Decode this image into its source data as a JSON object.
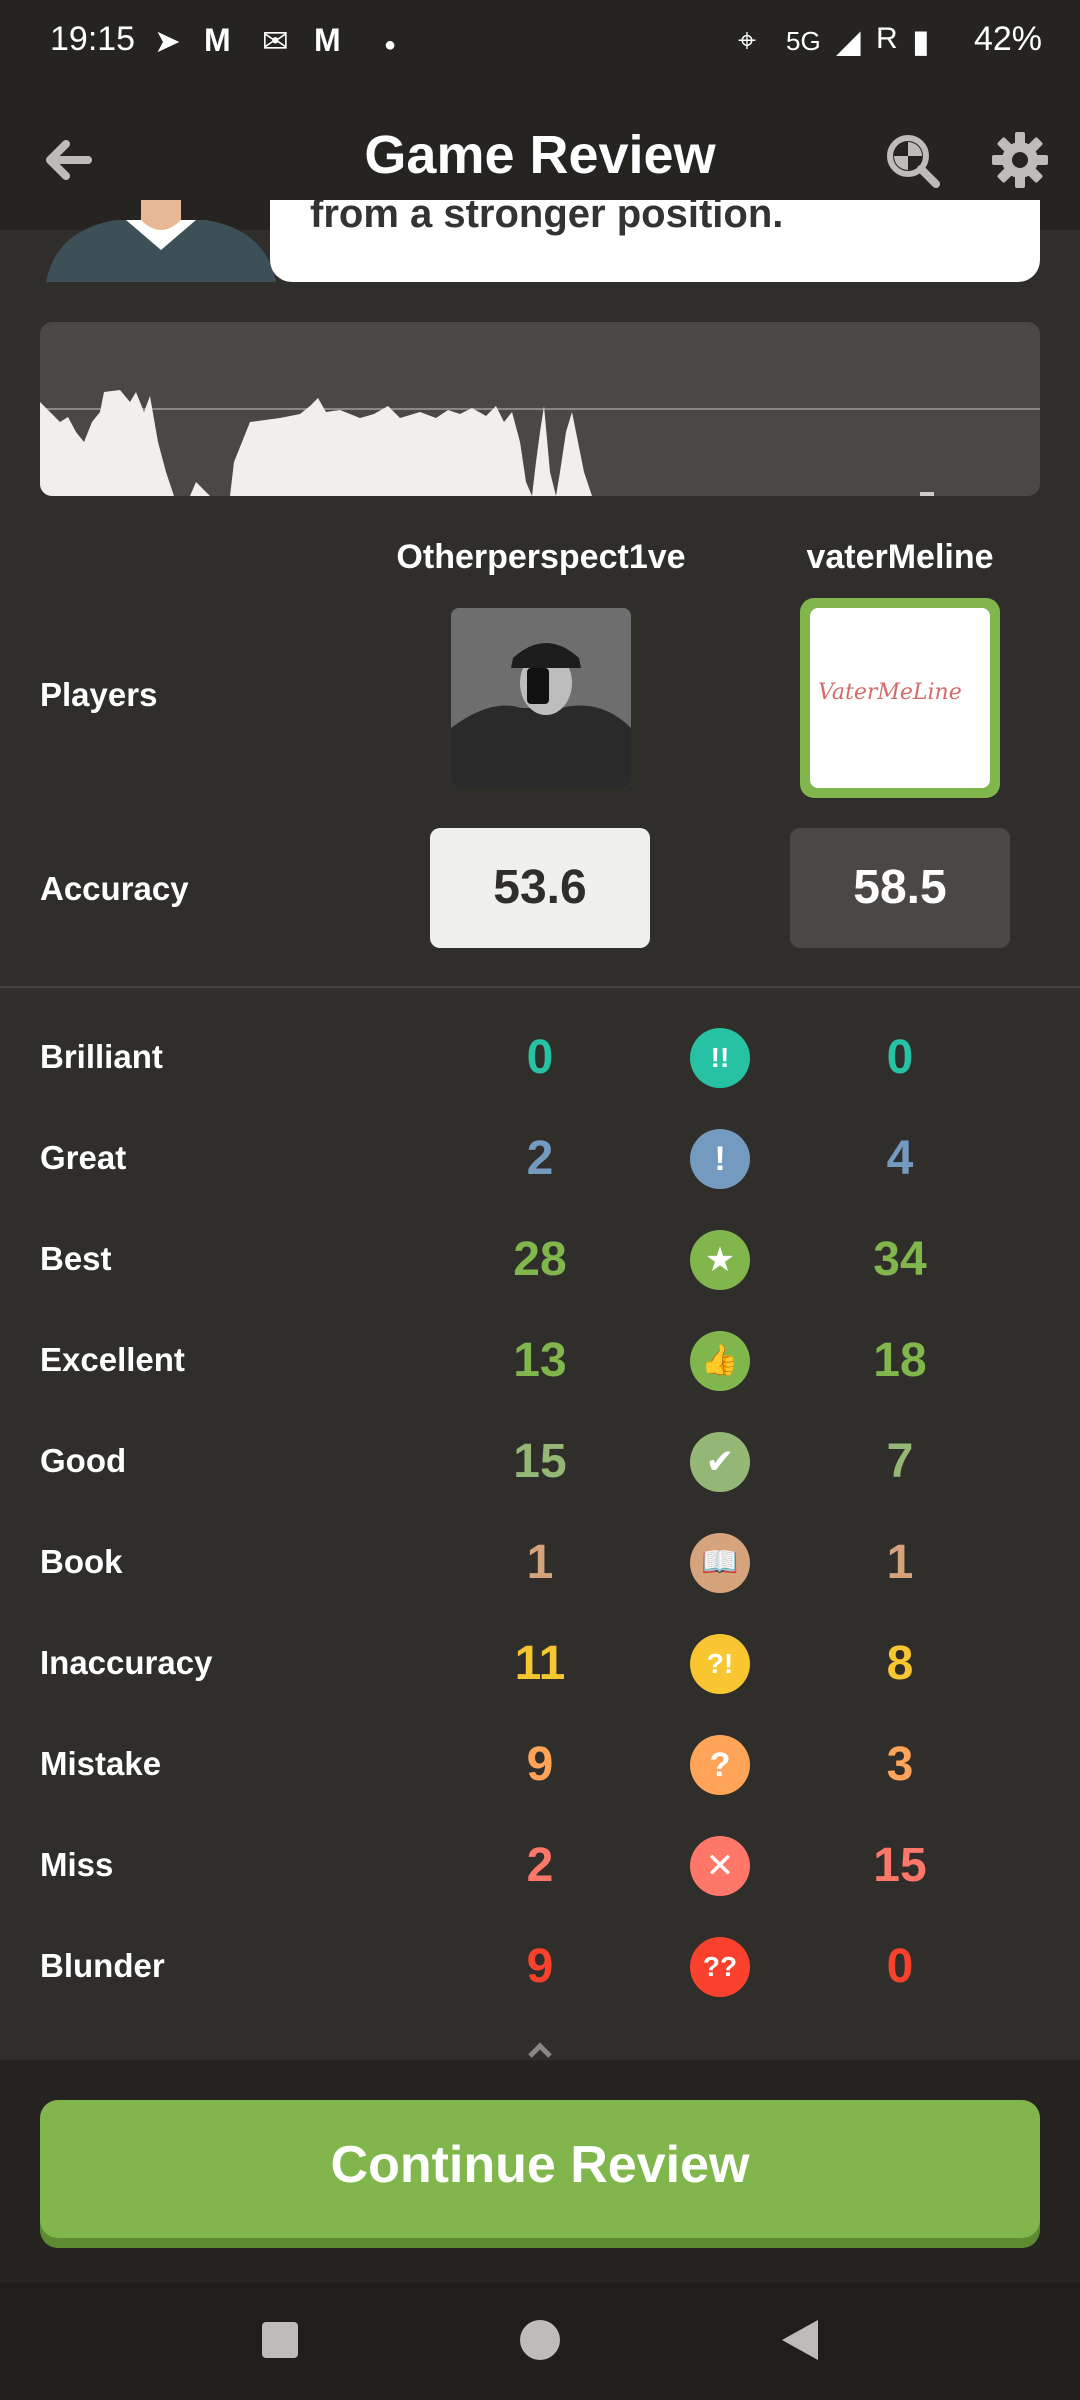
{
  "status_bar": {
    "time": "19:15",
    "network": "5G",
    "roaming": "R",
    "battery": "42%"
  },
  "header": {
    "title": "Game Review"
  },
  "coach": {
    "message": "from a stronger position."
  },
  "players": {
    "label": "Players",
    "white": {
      "name": "Otherperspect1ve",
      "accuracy": "53.6"
    },
    "black": {
      "name": "vaterMeline",
      "accuracy": "58.5",
      "avatar_text": "VaterMeLine"
    }
  },
  "accuracy_label": "Accuracy",
  "stats": [
    {
      "label": "Brilliant",
      "white": "0",
      "black": "0",
      "color": "#26c2a3",
      "icon": "!!",
      "icon_name": "brilliant-icon"
    },
    {
      "label": "Great",
      "white": "2",
      "black": "4",
      "color": "#749bbf",
      "icon": "!",
      "icon_name": "great-icon"
    },
    {
      "label": "Best",
      "white": "28",
      "black": "34",
      "color": "#81b64c",
      "icon": "★",
      "icon_name": "star-icon"
    },
    {
      "label": "Excellent",
      "white": "13",
      "black": "18",
      "color": "#81b64c",
      "icon": "👍",
      "icon_name": "thumbs-up-icon"
    },
    {
      "label": "Good",
      "white": "15",
      "black": "7",
      "color": "#95b776",
      "icon": "✔",
      "icon_name": "check-icon"
    },
    {
      "label": "Book",
      "white": "1",
      "black": "1",
      "color": "#d5a47d",
      "icon": "📖",
      "icon_name": "book-icon"
    },
    {
      "label": "Inaccuracy",
      "white": "11",
      "black": "8",
      "color": "#f7c631",
      "icon": "?!",
      "icon_name": "inaccuracy-icon"
    },
    {
      "label": "Mistake",
      "white": "9",
      "black": "3",
      "color": "#ffa459",
      "icon": "?",
      "icon_name": "question-icon"
    },
    {
      "label": "Miss",
      "white": "2",
      "black": "15",
      "color": "#ff7769",
      "icon": "✕",
      "icon_name": "x-icon"
    },
    {
      "label": "Blunder",
      "white": "9",
      "black": "0",
      "color": "#fa412d",
      "icon": "??",
      "icon_name": "blunder-icon"
    }
  ],
  "continue_button": "Continue Review"
}
